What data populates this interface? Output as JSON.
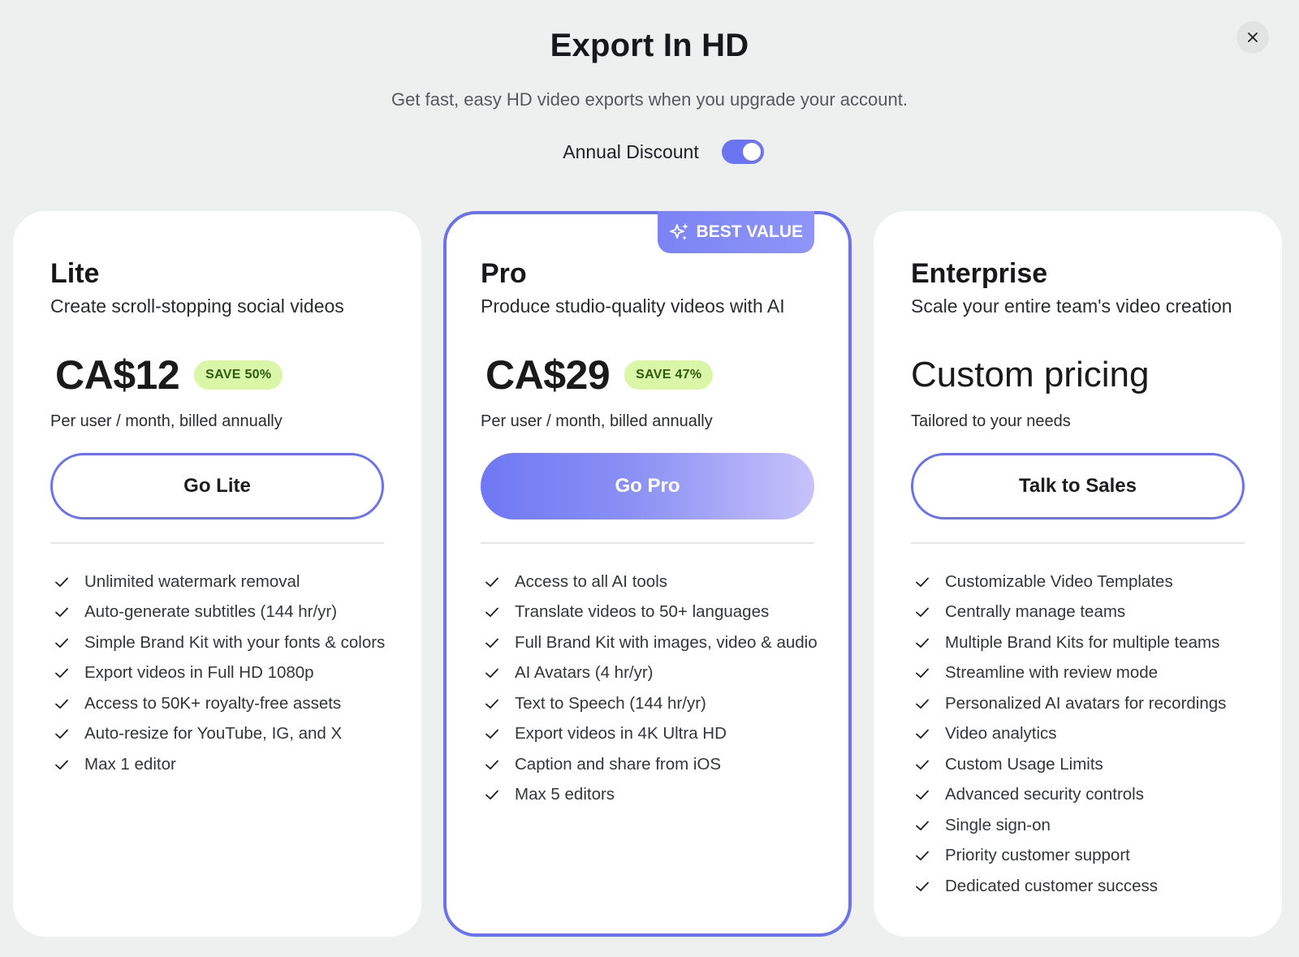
{
  "header": {
    "title": "Export In HD",
    "subtitle": "Get fast, easy HD video exports when you upgrade your account.",
    "toggle_label": "Annual Discount",
    "toggle_on": true,
    "close_icon": "close-icon"
  },
  "colors": {
    "accent": "#6a72ee",
    "save_badge_bg": "#d9f7a7",
    "background": "#eef0f0"
  },
  "plans": [
    {
      "name": "Lite",
      "description": "Create scroll-stopping social videos",
      "price": "CA$12",
      "save": "SAVE 50%",
      "billing": "Per user / month, billed annually",
      "cta": "Go Lite",
      "features": [
        "Unlimited watermark removal",
        "Auto-generate subtitles (144 hr/yr)",
        "Simple Brand Kit with your fonts & colors",
        "Export videos in Full HD 1080p",
        "Access to 50K+ royalty-free assets",
        "Auto-resize for YouTube, IG, and X",
        "Max 1 editor"
      ]
    },
    {
      "name": "Pro",
      "badge": "BEST VALUE",
      "description": "Produce studio-quality videos with AI",
      "price": "CA$29",
      "save": "SAVE 47%",
      "billing": "Per user / month, billed annually",
      "cta": "Go Pro",
      "features": [
        "Access to all AI tools",
        "Translate videos to 50+ languages",
        "Full Brand Kit with images, video & audio",
        "AI Avatars (4 hr/yr)",
        "Text to Speech (144 hr/yr)",
        "Export videos in 4K Ultra HD",
        "Caption and share from iOS",
        "Max 5 editors"
      ]
    },
    {
      "name": "Enterprise",
      "description": "Scale your entire team's video creation",
      "price": "Custom pricing",
      "billing": "Tailored to your needs",
      "cta": "Talk to Sales",
      "features": [
        "Customizable Video Templates",
        "Centrally manage teams",
        "Multiple Brand Kits for multiple teams",
        "Streamline with review mode",
        "Personalized AI avatars for recordings",
        "Video analytics",
        "Custom Usage Limits",
        "Advanced security controls",
        "Single sign-on",
        "Priority customer support",
        "Dedicated customer success"
      ]
    }
  ]
}
